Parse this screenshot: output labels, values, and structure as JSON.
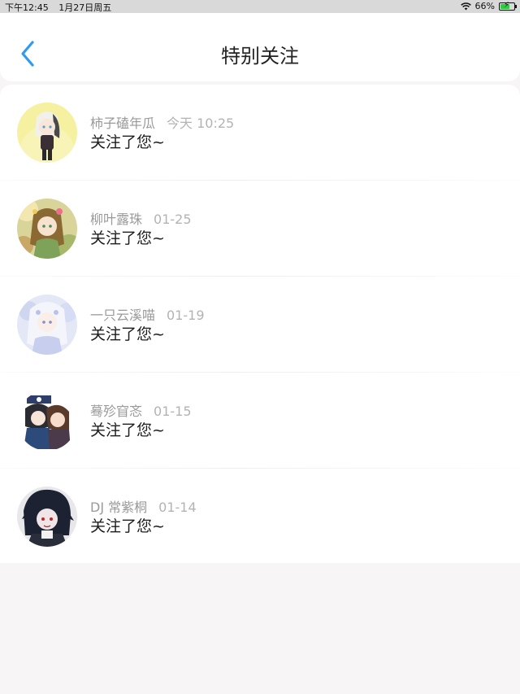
{
  "status_bar": {
    "time": "下午12:45",
    "date": "1月27日周五",
    "battery": "66%",
    "battery_level": 0.66
  },
  "header": {
    "title": "特别关注"
  },
  "items": [
    {
      "name": "柿子磕年瓜",
      "time": "今天 10:25",
      "message": "关注了您~"
    },
    {
      "name": "柳叶露珠",
      "time": "01-25",
      "message": "关注了您~"
    },
    {
      "name": "一只云溪喵",
      "time": "01-19",
      "message": "关注了您~"
    },
    {
      "name": "蓦殄窅忞",
      "time": "01-15",
      "message": "关注了您~"
    },
    {
      "name": "DJ 常紫桐",
      "time": "01-14",
      "message": "关注了您~"
    }
  ],
  "colors": {
    "accent": "#2f9bf0",
    "background": "#f7f5f5"
  }
}
